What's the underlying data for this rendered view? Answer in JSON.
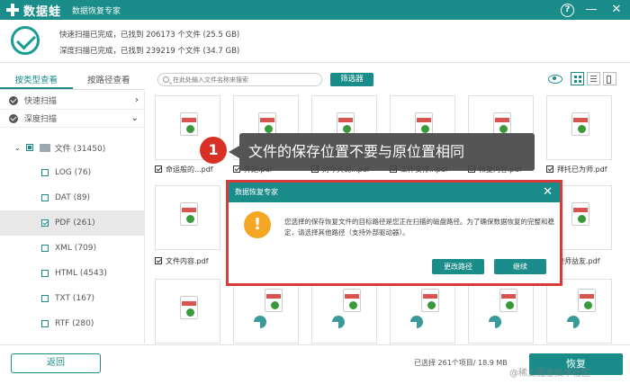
{
  "titlebar": {
    "logo_text": "数据蛙",
    "app_name": "数据恢复专家",
    "help": "?",
    "minimize": "—",
    "close": "✕"
  },
  "summary": {
    "line1": "快速扫描已完成，已找到 206173 个文件 (25.5 GB)",
    "line2": "深度扫描已完成，已找到 239219 个文件 (34.7 GB)"
  },
  "tabs": [
    {
      "label": "按类型查看",
      "active": true
    },
    {
      "label": "按路径查看",
      "active": false
    }
  ],
  "sidebar": {
    "scans": [
      {
        "label": "快速扫描",
        "chevron": "›"
      },
      {
        "label": "深度扫描",
        "chevron": "⌄"
      }
    ],
    "root": {
      "caret": "⌄",
      "label": "文件 (31450)"
    },
    "children": [
      {
        "label": "LOG (76)"
      },
      {
        "label": "DAT (89)"
      },
      {
        "label": "PDF (261)"
      },
      {
        "label": "XML (709)"
      },
      {
        "label": "HTML (4543)"
      },
      {
        "label": "TXT (167)"
      },
      {
        "label": "RTF (280)"
      }
    ]
  },
  "toolbar": {
    "search_placeholder": "在此处输入文件名称来搜索",
    "filter_label": "筛选器"
  },
  "files_row1": [
    {
      "name": "命运般的...pdf"
    },
    {
      "name": "奔跑.pdf"
    },
    {
      "name": "对今天说...pdf"
    },
    {
      "name": "工作安排...pdf"
    },
    {
      "name": "恢复内容.pdf"
    },
    {
      "name": "拜托已为师.pdf"
    }
  ],
  "files_row2": [
    {
      "name": "文件内容.pdf"
    },
    {
      "name": "良师益友.pdf"
    }
  ],
  "callout": {
    "number": "1",
    "text": "文件的保存位置不要与原位置相同"
  },
  "dialog": {
    "title": "数据恢复专家",
    "close": "✕",
    "icon": "!",
    "message": "您选择的保存恢复文件的目标路径是您正在扫描的磁盘路径。为了确保数据恢复的完整和稳定，请选择其他路径（支持外部驱动器）。",
    "change_path": "更改路径",
    "continue": "继续"
  },
  "bottom": {
    "back_label": "返回",
    "selected_info": "已选择 261个项目/ 18.9 MB",
    "recover_label": "恢复",
    "watermark": "@稀土掘金技术社区"
  }
}
